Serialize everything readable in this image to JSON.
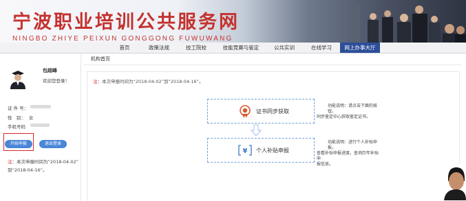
{
  "banner": {
    "title": "宁波职业培训公共服务网",
    "pinyin": "NINGBO ZHIYE PEIXUN GONGGONG FUWUWANG"
  },
  "nav": {
    "items": [
      "首页",
      "政策法规",
      "技工院校",
      "技能竞赛与鉴定",
      "公共实训",
      "在线学习",
      "网上办事大厅"
    ],
    "active_index": 6
  },
  "sidebar": {
    "user_name": "包超峰",
    "welcome": "欢迎您登录！",
    "id_label": "证 件 号：",
    "gender_label": "性　别：",
    "gender_value": "女",
    "phone_label": "手机号码",
    "buttons": [
      "开始申报",
      "退出登录"
    ],
    "note_tag": "注",
    "note_lines": [
      "：本次申报时间为“2018-04-02”",
      "到“2018-04-16”。"
    ]
  },
  "main": {
    "breadcrumb": "机构首页",
    "note_tag": "注",
    "note_text": "：本次申报时间为“2018-04-02”到“2018-04-16”。",
    "cards": [
      {
        "label": "证书同步获取",
        "icon": "certificate-icon",
        "desc_lines": [
          "功能说明：请点击下面的按钮，",
          "同步鉴定中心获取鉴定证书。"
        ]
      },
      {
        "label": "个人补贴申报",
        "icon": "yen-icon",
        "desc_lines": [
          "功能说明：进行个人补贴申报，",
          "查看补贴申报进度，查询历年补贴申",
          "报信息。"
        ]
      }
    ]
  },
  "colors": {
    "brand_red": "#c4322f",
    "nav_active": "#2c4f99",
    "button_blue": "#4a86d8",
    "highlight_red": "#d8262b",
    "card_border": "#6fa0d8"
  }
}
